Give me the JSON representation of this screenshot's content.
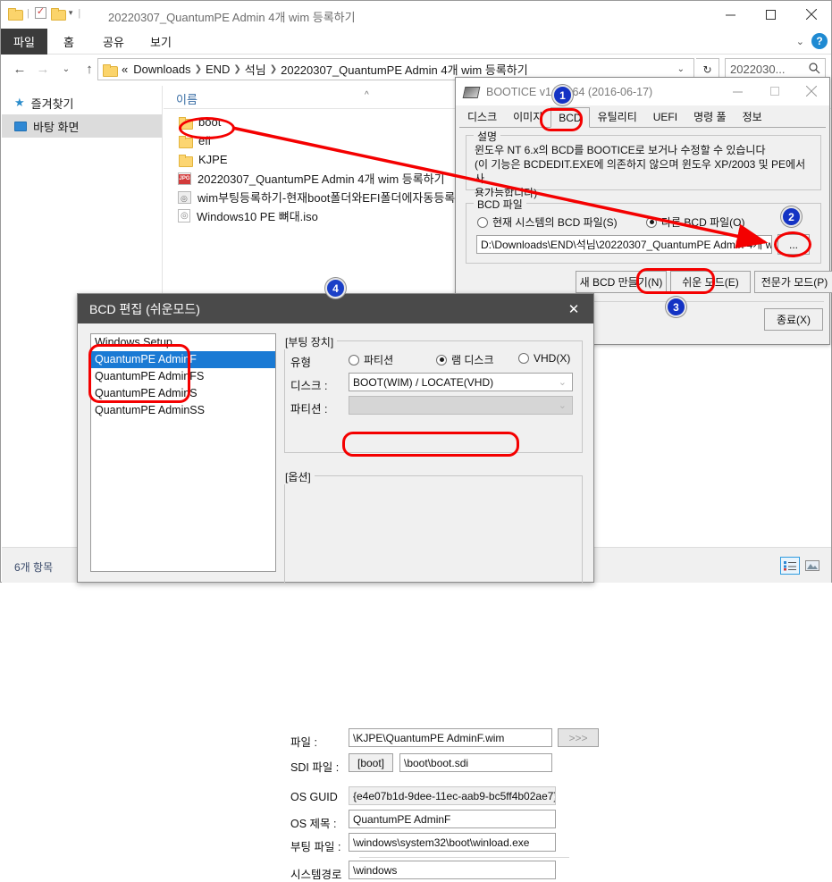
{
  "explorer": {
    "title": "20220307_QuantumPE Admin 4개 wim 등록하기",
    "quick_access": {
      "folder_icon": "folder-icon",
      "properties_icon": "checkbox-icon",
      "newfolder_icon": "folder-icon",
      "caret": "▾"
    },
    "window_controls": {
      "minimize": "—",
      "maximize": "▢",
      "close": "✕"
    },
    "ribbon_tabs": [
      {
        "label": "파일"
      },
      {
        "label": "홈"
      },
      {
        "label": "공유"
      },
      {
        "label": "보기"
      }
    ],
    "ribbon_right": {
      "caret": "⌄",
      "help": "?"
    },
    "nav": {
      "back": "←",
      "forward": "→",
      "recent": "⌄",
      "up": "↑"
    },
    "breadcrumbs": [
      {
        "label": "«"
      },
      {
        "label": "Downloads"
      },
      {
        "label": "END"
      },
      {
        "label": "석님"
      },
      {
        "label": "20220307_QuantumPE Admin 4개 wim 등록하기"
      }
    ],
    "address_caret": "⌄",
    "refresh": "↻",
    "search": {
      "value": "2022030...",
      "icon": "search-icon"
    },
    "sidebar": [
      {
        "label": "즐겨찾기",
        "icon": "star-icon",
        "selected": false
      },
      {
        "label": "바탕 화면",
        "icon": "monitor-icon",
        "selected": true
      }
    ],
    "column_header": {
      "name": "이름",
      "sort_caret": "^"
    },
    "files": [
      {
        "name": "boot",
        "type": "folder"
      },
      {
        "name": "efi",
        "type": "folder"
      },
      {
        "name": "KJPE",
        "type": "folder"
      },
      {
        "name": "20220307_QuantumPE Admin 4개 wim 등록하기",
        "type": "jpg",
        "badge": "JPG"
      },
      {
        "name": "wim부팅등록하기-현재boot폴더와EFI폴더에자동등록",
        "type": "link",
        "badge": "◎"
      },
      {
        "name": "Windows10 PE 뼈대.iso",
        "type": "iso",
        "badge": "◎"
      }
    ],
    "status": {
      "count": "6개 항목"
    },
    "view_buttons": [
      {
        "name": "details-view",
        "active": true
      },
      {
        "name": "large-icons-view",
        "active": false
      }
    ]
  },
  "bootice": {
    "title": "BOOTICE v1.3.  x64 (2016-06-17)",
    "window_controls": {
      "minimize": "—",
      "maximize": "▢",
      "close": "✕"
    },
    "tabs": [
      {
        "label": "디스크",
        "active": false
      },
      {
        "label": "이미지",
        "active": false
      },
      {
        "label": "BCD",
        "active": true
      },
      {
        "label": "유틸리티",
        "active": false
      },
      {
        "label": "UEFI",
        "active": false
      },
      {
        "label": "명령 풀",
        "active": false
      },
      {
        "label": "정보",
        "active": false
      }
    ],
    "description_group": {
      "label": "설명",
      "line1": "윈도우 NT 6.x의 BCD를 BOOTICE로 보거나 수정할 수 있습니다",
      "line2": "(이 기능은 BCDEDIT.EXE에 의존하지 않으며 윈도우 XP/2003 및 PE에서 사",
      "line3": "용가능합니다)"
    },
    "bcd_file_group": {
      "label": "BCD 파일",
      "radio_current": "현재 시스템의 BCD 파일(S)",
      "radio_other": "다른 BCD 파일(O)",
      "selected": "other",
      "path_value": "D:\\Downloads\\END\\석님\\20220307_QuantumPE Admin 4개 wi",
      "browse_label": "..."
    },
    "buttons": {
      "new_bcd": "새 BCD 만들기(N)",
      "easy_mode": "쉬운 모드(E)",
      "expert_mode": "전문가 모드(P)",
      "exit": "종료(X)"
    }
  },
  "bcd_edit": {
    "title": "BCD 편집 (쉬운모드)",
    "close": "✕",
    "entries": [
      {
        "label": "Windows Setup",
        "selected": false
      },
      {
        "label": "QuantumPE AdminF",
        "selected": true
      },
      {
        "label": "QuantumPE AdminFS",
        "selected": false
      },
      {
        "label": "QuantumPE AdminS",
        "selected": false
      },
      {
        "label": "QuantumPE AdminSS",
        "selected": false
      }
    ],
    "boot_device": {
      "group_label": "[부팅 장치]",
      "type_label": "유형",
      "type_options": [
        {
          "label": "파티션",
          "selected": false
        },
        {
          "label": "램 디스크",
          "selected": true
        },
        {
          "label": "VHD(X)",
          "selected": false
        }
      ],
      "disk_label": "디스크 :",
      "disk_value": "BOOT(WIM) / LOCATE(VHD)",
      "partition_label": "파티션 :",
      "partition_value": "",
      "file_label": "파일 :",
      "file_value": "\\KJPE\\QuantumPE AdminF.wim",
      "file_browse": ">>>",
      "sdi_label": "SDI 파일 :",
      "sdi_button": "[boot]",
      "sdi_value": "\\boot\\boot.sdi"
    },
    "options": {
      "group_label": "[옵션]",
      "os_guid_label": "OS GUID",
      "os_guid_value": "{e4e07b1d-9dee-11ec-aab9-bc5ff4b02ae7}",
      "os_title_label": "OS 제목 :",
      "os_title_value": "QuantumPE AdminF",
      "boot_file_label": "부팅 파일 :",
      "boot_file_value": "\\windows\\system32\\boot\\winload.exe",
      "system_path_label": "시스템경로",
      "system_path_value": "\\windows"
    }
  },
  "annotations": {
    "badges": [
      {
        "label": "1"
      },
      {
        "label": "2"
      },
      {
        "label": "3"
      },
      {
        "label": "4"
      }
    ],
    "accent_color": "#f40000",
    "badge_color": "#1433c4"
  }
}
